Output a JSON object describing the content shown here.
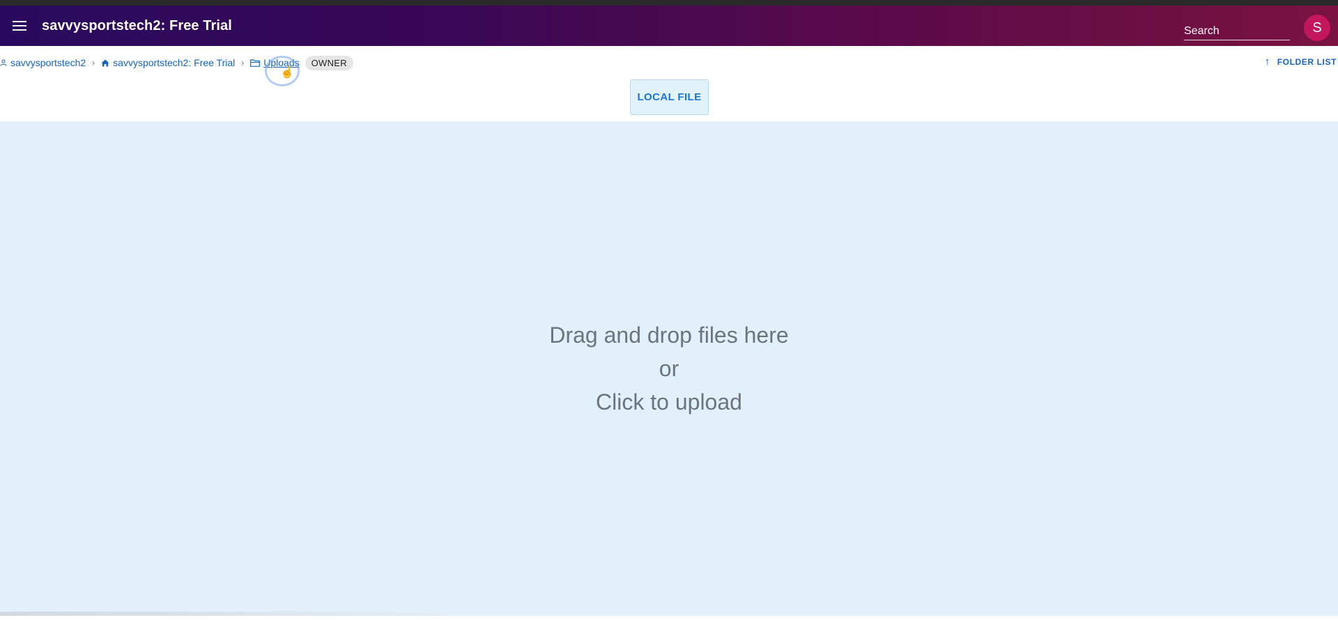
{
  "appbar": {
    "title": "savvysportstech2: Free Trial",
    "search_placeholder": "Search",
    "avatar_initial": "S"
  },
  "breadcrumb": {
    "items": [
      {
        "label": "savvysportstech2",
        "icon": "person-icon"
      },
      {
        "label": "savvysportstech2: Free Trial",
        "icon": "home-icon"
      },
      {
        "label": "Uploads",
        "icon": "folder-icon"
      }
    ],
    "separator": "›",
    "role_badge": "OWNER"
  },
  "folder_list": {
    "label": "FOLDER LIST",
    "icon": "arrow-up-icon"
  },
  "upload": {
    "local_file_label": "LOCAL FILE",
    "dropzone_lines": [
      "Drag and drop files here",
      "or",
      "Click to upload"
    ]
  },
  "colors": {
    "appbar_start": "#2a0a5e",
    "appbar_end": "#7a1240",
    "link": "#1565c0",
    "dropzone_bg": "#e2f0fc",
    "avatar_bg": "#c2185b"
  }
}
